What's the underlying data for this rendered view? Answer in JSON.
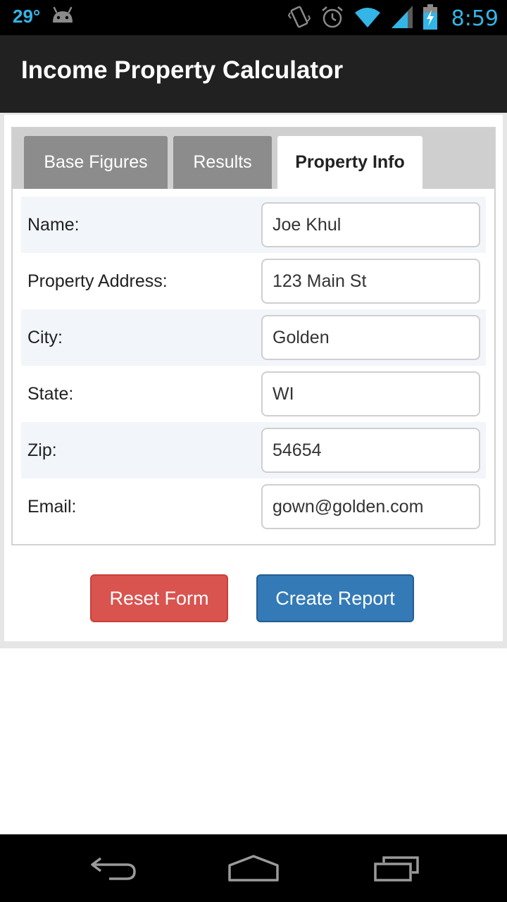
{
  "status_bar": {
    "temperature": "29°",
    "time": "8:59",
    "icons": [
      "android-icon",
      "vibrate-icon",
      "alarm-icon",
      "wifi-icon",
      "signal-icon",
      "battery-charging-icon"
    ]
  },
  "app": {
    "title": "Income Property Calculator"
  },
  "tabs": [
    {
      "label": "Base Figures",
      "active": false
    },
    {
      "label": "Results",
      "active": false
    },
    {
      "label": "Property Info",
      "active": true
    }
  ],
  "form": {
    "fields": [
      {
        "label": "Name:",
        "value": "Joe Khul"
      },
      {
        "label": "Property Address:",
        "value": "123 Main St"
      },
      {
        "label": "City:",
        "value": "Golden"
      },
      {
        "label": "State:",
        "value": "WI"
      },
      {
        "label": "Zip:",
        "value": "54654"
      },
      {
        "label": "Email:",
        "value": "gown@golden.com"
      }
    ]
  },
  "buttons": {
    "reset_label": "Reset Form",
    "create_label": "Create Report"
  },
  "nav": {
    "icons": [
      "back-icon",
      "home-icon",
      "recent-apps-icon"
    ]
  },
  "colors": {
    "accent": "#33b5e5",
    "reset": "#d9534f",
    "create": "#337ab7",
    "active_tab": "#ffffff",
    "inactive_tab": "#8c8c8c"
  }
}
